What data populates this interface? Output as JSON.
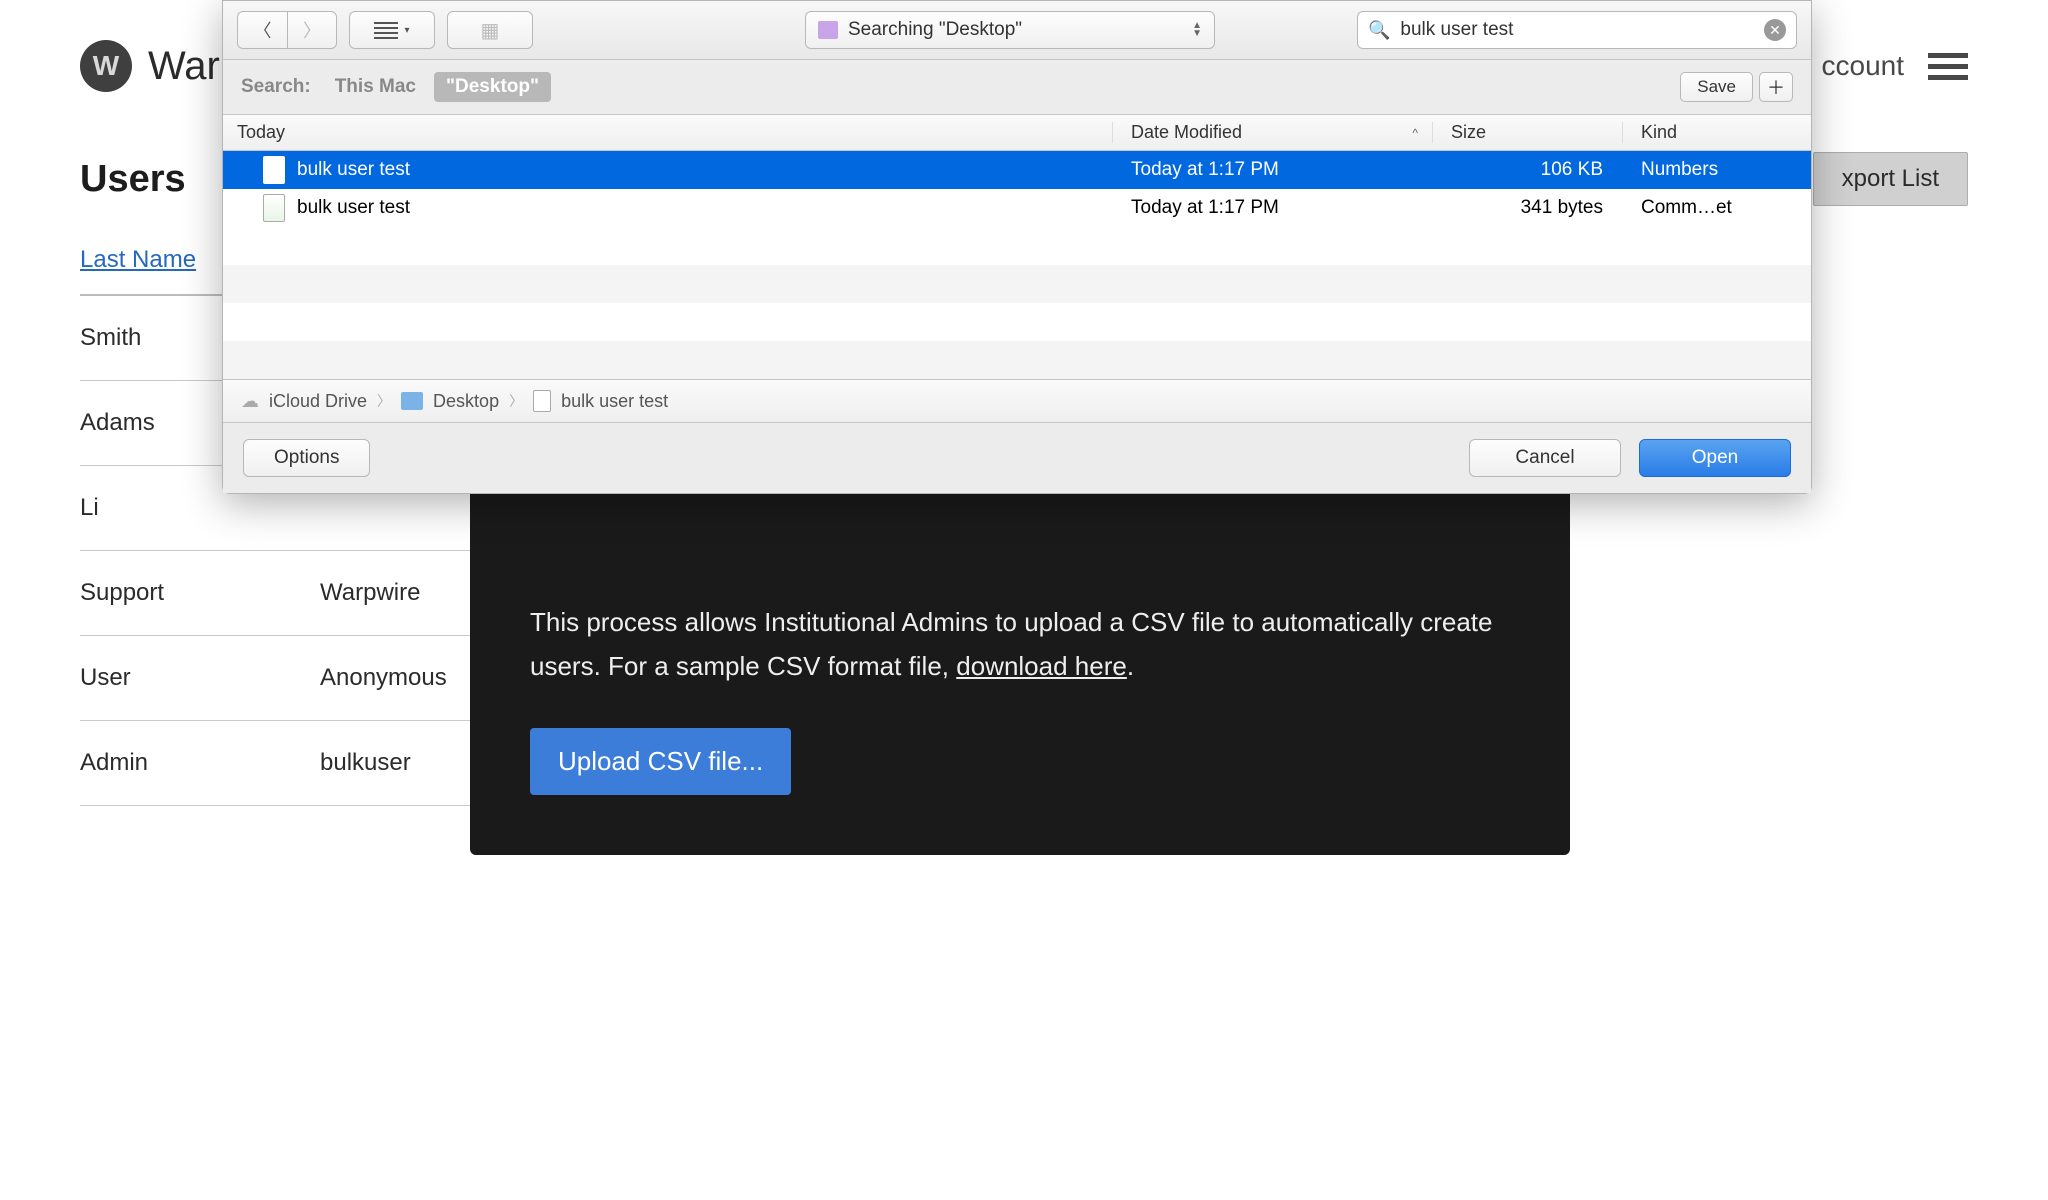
{
  "bg": {
    "logo_letter": "W",
    "app_name": "Warp",
    "account_label": "ccount",
    "page_title": "Users",
    "export_label": "xport List",
    "table": {
      "header_lastname": "Last Name",
      "rows": [
        {
          "last": "Smith",
          "first": ""
        },
        {
          "last": "Adams",
          "first": ""
        },
        {
          "last": "Li",
          "first": ""
        },
        {
          "last": "Support",
          "first": "Warpwire"
        },
        {
          "last": "User",
          "first": "Anonymous"
        },
        {
          "last": "Admin",
          "first": "bulkuser"
        }
      ]
    }
  },
  "dark_modal": {
    "text_part1": "This process allows Institutional Admins to upload a CSV file to automatically create users. For a sample CSV format file, ",
    "link_text": "download here",
    "text_part2": ".",
    "upload_btn": "Upload CSV file..."
  },
  "picker": {
    "location_text": "Searching \"Desktop\"",
    "search_value": "bulk user test",
    "search_label": "Search:",
    "scope_thismac": "This Mac",
    "scope_desktop": "\"Desktop\"",
    "save_label": "Save",
    "columns": {
      "name": "Today",
      "date": "Date Modified",
      "size": "Size",
      "kind": "Kind"
    },
    "files": [
      {
        "name": "bulk user test",
        "date": "Today at 1:17 PM",
        "size": "106 KB",
        "kind": "Numbers",
        "selected": true,
        "icon": "doc"
      },
      {
        "name": "bulk user test",
        "date": "Today at 1:17 PM",
        "size": "341 bytes",
        "kind": "Comm…et",
        "selected": false,
        "icon": "csv"
      }
    ],
    "path": {
      "icloud": "iCloud Drive",
      "desktop": "Desktop",
      "file": "bulk user test"
    },
    "options_label": "Options",
    "cancel_label": "Cancel",
    "open_label": "Open"
  }
}
